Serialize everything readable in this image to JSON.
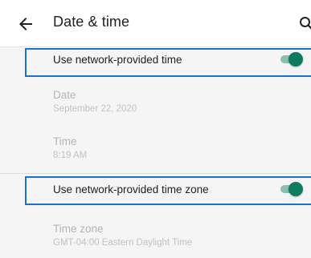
{
  "header": {
    "title": "Date & time"
  },
  "settings": {
    "auto_time": {
      "title": "Use network-provided time",
      "enabled": true
    },
    "date": {
      "title": "Date",
      "value": "September 22, 2020"
    },
    "time": {
      "title": "Time",
      "value": "8:19 AM"
    },
    "auto_zone": {
      "title": "Use network-provided time zone",
      "enabled": true
    },
    "time_zone": {
      "title": "Time zone",
      "value": "GMT-04:00 Eastern Daylight Time"
    }
  },
  "colors": {
    "toggle_on_thumb": "#0e7a5f",
    "toggle_on_track": "#8cbfae",
    "highlight_border": "#1a73c9",
    "background": "#f5f5f5"
  },
  "icons": {
    "back": "arrow-back-icon",
    "search": "search-icon"
  }
}
